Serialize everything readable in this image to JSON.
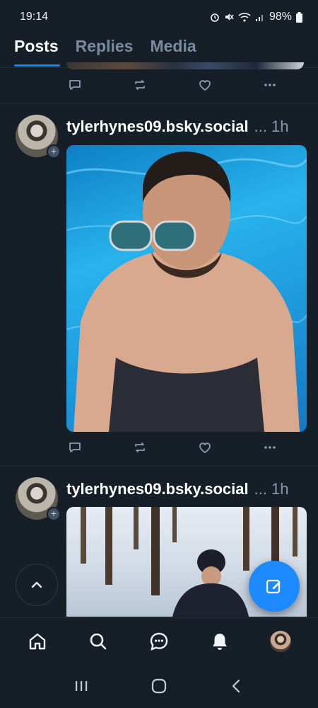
{
  "status_bar": {
    "time": "19:14",
    "battery": "98%",
    "icons": [
      "alarm-icon",
      "mute-icon",
      "wifi-icon",
      "signal-icon",
      "battery-icon"
    ]
  },
  "tabs": [
    {
      "label": "Posts",
      "active": true
    },
    {
      "label": "Replies",
      "active": false
    },
    {
      "label": "Media",
      "active": false
    }
  ],
  "posts": [
    {
      "handle": "tylerhynes09.bsky.social",
      "ellipsis": "...",
      "time": "1h",
      "media": "pool-selfie-image"
    },
    {
      "handle": "tylerhynes09.bsky.social",
      "ellipsis": "...",
      "time": "1h",
      "media": "snow-forest-image"
    }
  ],
  "post_actions": [
    "reply-icon",
    "repost-icon",
    "like-icon",
    "more-icon"
  ],
  "bottom_nav": [
    "home-icon",
    "search-icon",
    "chat-icon",
    "notifications-icon",
    "profile-avatar"
  ],
  "colors": {
    "background": "#161e27",
    "accent": "#1083fe",
    "muted": "#8a9bb0",
    "fab": "#1d8bff"
  }
}
